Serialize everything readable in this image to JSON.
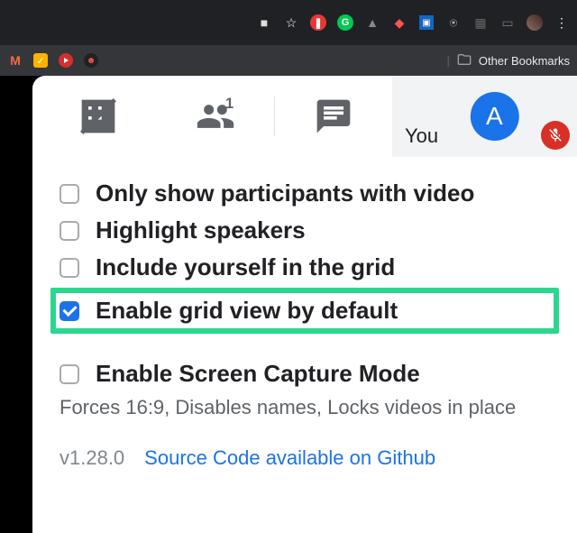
{
  "chrome": {
    "other_bookmarks": "Other Bookmarks"
  },
  "tile": {
    "you_label": "You",
    "avatar_initial": "A"
  },
  "options": {
    "items": [
      {
        "label": "Only show participants with video",
        "checked": false,
        "highlight": false
      },
      {
        "label": "Highlight speakers",
        "checked": false,
        "highlight": false
      },
      {
        "label": "Include yourself in the grid",
        "checked": false,
        "highlight": false
      },
      {
        "label": "Enable grid view by default",
        "checked": true,
        "highlight": true
      }
    ],
    "capture": {
      "label": "Enable Screen Capture Mode",
      "checked": false,
      "description": "Forces 16:9, Disables names, Locks videos in place"
    }
  },
  "footer": {
    "version": "v1.28.0",
    "link_text": "Source Code available on Github"
  }
}
